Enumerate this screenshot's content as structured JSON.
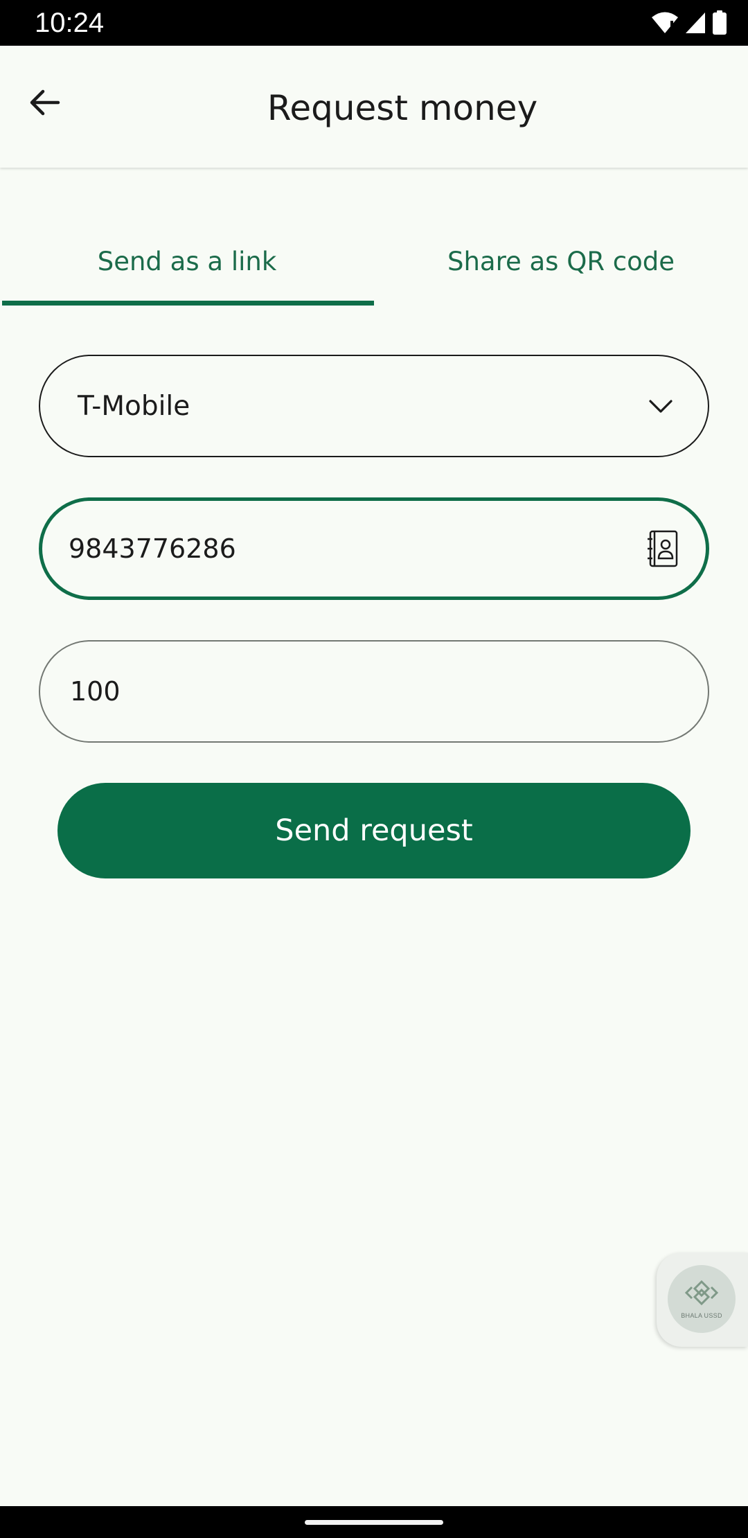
{
  "status_bar": {
    "time": "10:24"
  },
  "app_bar": {
    "title": "Request money"
  },
  "tabs": [
    {
      "label": "Send as a link",
      "selected": true
    },
    {
      "label": "Share as QR code",
      "selected": false
    }
  ],
  "form": {
    "carrier": {
      "value": "T-Mobile"
    },
    "phone": {
      "value": "9843776286"
    },
    "amount": {
      "value": "100"
    },
    "submit_label": "Send request"
  },
  "ussd_widget": {
    "label": "BHALA USSD"
  },
  "icons": {
    "back": "arrow-left-icon",
    "dropdown": "chevron-down-icon",
    "contacts": "contact-book-icon",
    "wifi": "wifi-icon",
    "signal": "signal-icon",
    "battery": "battery-icon"
  },
  "colors": {
    "accent": "#0f6e49",
    "background": "#f8fbf6",
    "button_text": "#ffffff"
  }
}
